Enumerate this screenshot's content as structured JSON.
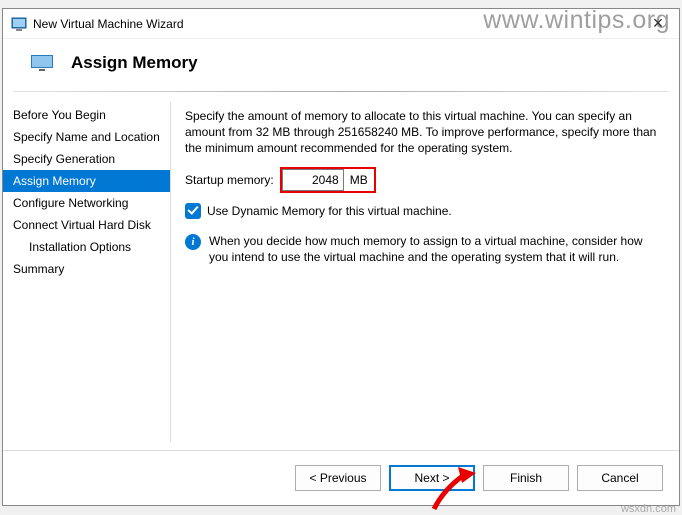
{
  "window": {
    "title": "New Virtual Machine Wizard",
    "close_label": "×"
  },
  "watermarks": {
    "top": "www.wintips.org",
    "bottom": "wsxdn.com"
  },
  "header": {
    "title": "Assign Memory"
  },
  "sidebar": {
    "items": [
      {
        "label": "Before You Begin"
      },
      {
        "label": "Specify Name and Location"
      },
      {
        "label": "Specify Generation"
      },
      {
        "label": "Assign Memory"
      },
      {
        "label": "Configure Networking"
      },
      {
        "label": "Connect Virtual Hard Disk"
      },
      {
        "label": "Installation Options"
      },
      {
        "label": "Summary"
      }
    ],
    "selected_index": 3
  },
  "main": {
    "description": "Specify the amount of memory to allocate to this virtual machine. You can specify an amount from 32 MB through 251658240 MB. To improve performance, specify more than the minimum amount recommended for the operating system.",
    "startup_label": "Startup memory:",
    "startup_value": "2048",
    "startup_unit": "MB",
    "dynamic_checkbox_label": "Use Dynamic Memory for this virtual machine.",
    "dynamic_checked": true,
    "info_text": "When you decide how much memory to assign to a virtual machine, consider how you intend to use the virtual machine and the operating system that it will run."
  },
  "buttons": {
    "previous": "< Previous",
    "next": "Next >",
    "finish": "Finish",
    "cancel": "Cancel"
  },
  "colors": {
    "accent": "#0078d4",
    "highlight": "#e80000"
  }
}
